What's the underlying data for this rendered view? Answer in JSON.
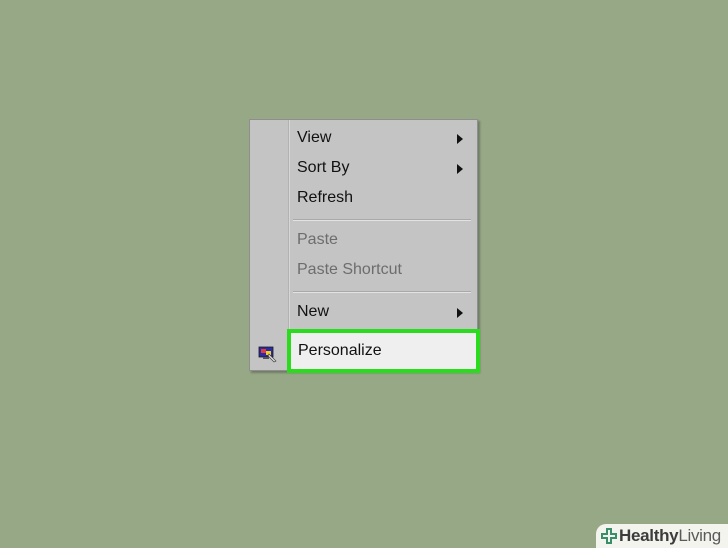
{
  "desktop": {
    "background_color": "#97a887"
  },
  "context_menu": {
    "items": [
      {
        "label": "View",
        "enabled": true,
        "has_submenu": true
      },
      {
        "label": "Sort By",
        "enabled": true,
        "has_submenu": true
      },
      {
        "label": "Refresh",
        "enabled": true,
        "has_submenu": false
      },
      {
        "label": "Paste",
        "enabled": false,
        "has_submenu": false
      },
      {
        "label": "Paste Shortcut",
        "enabled": false,
        "has_submenu": false
      },
      {
        "label": "New",
        "enabled": true,
        "has_submenu": true
      },
      {
        "label": "Personalize",
        "enabled": true,
        "has_submenu": false,
        "icon": "personalize-icon",
        "highlighted": true
      }
    ]
  },
  "highlight": {
    "color": "#2bdb1d"
  },
  "watermark": {
    "brand": "Healthy",
    "brand_suffix": "Living",
    "icon": "health-cross-icon"
  }
}
